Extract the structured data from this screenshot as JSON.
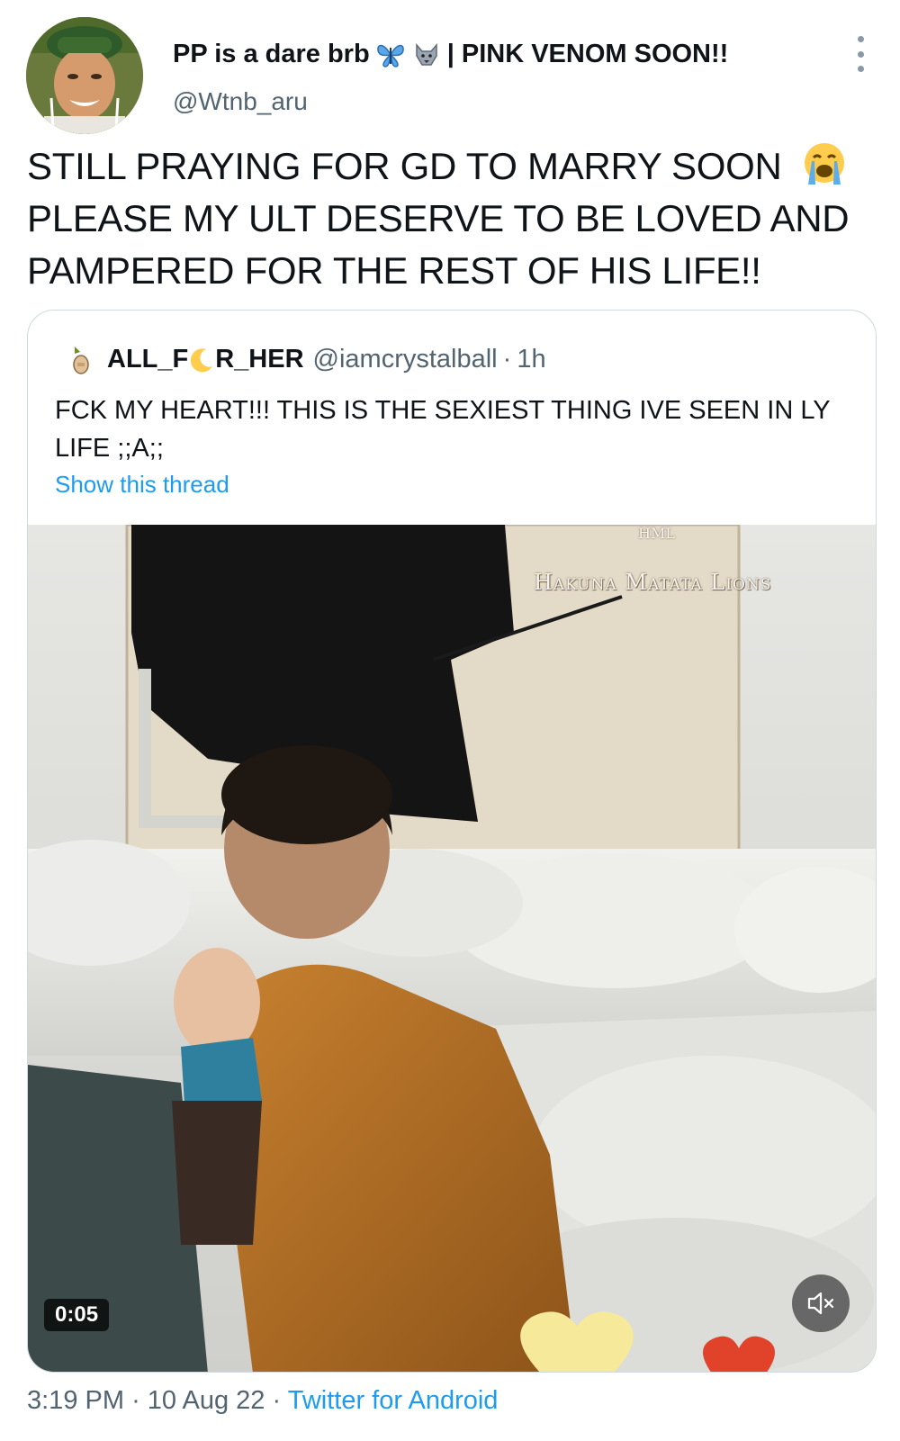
{
  "author": {
    "display_name": "PP is a dare brb",
    "name_suffix": "| PINK VENOM SOON!!",
    "name_emojis": [
      "butterfly-emoji",
      "wolf-emoji"
    ],
    "handle": "@Wtnb_aru"
  },
  "tweet": {
    "text": "STILL PRAYING FOR GD TO MARRY SOON",
    "text_rest": "PLEASE MY ULT DESERVE TO BE LOVED AND PAMPERED FOR THE REST OF HIS LIFE!!",
    "emoji": "loudly-crying-face-emoji"
  },
  "quote": {
    "name_part1": "ALL_F",
    "name_part2": "R_HER",
    "handle": "@iamcrystalball",
    "separator": "·",
    "time": "1h",
    "text": "FCK MY HEART!!! THIS IS THE SEXIEST THING IVE SEEN IN LY LIFE ;;A;;",
    "show_thread": "Show this thread",
    "video": {
      "duration": "0:05",
      "watermark_top": "HML",
      "watermark": "Hakuna Matata Lions"
    }
  },
  "meta": {
    "time": "3:19 PM",
    "date": "10 Aug 22",
    "separator": "·",
    "source": "Twitter for Android"
  },
  "colors": {
    "link": "#1d9bf0",
    "secondary_text": "#536471",
    "border": "#cfd9de"
  }
}
